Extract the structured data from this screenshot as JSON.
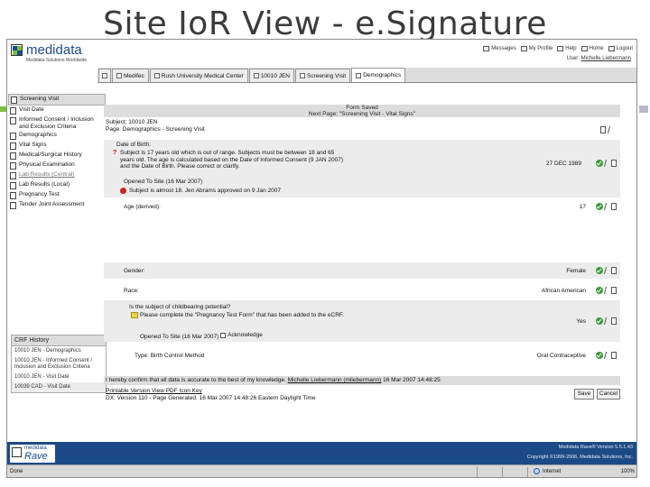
{
  "slide": {
    "title": "Site IoR View - e.Signature"
  },
  "header": {
    "logo_word": "medidata",
    "logo_tagline": "Medidata Solutions Worldwide",
    "links": [
      "Messages",
      "My Profile",
      "Help",
      "Home",
      "Logout"
    ],
    "user_prefix": "User:",
    "user_name": "Michelle Liebermann"
  },
  "tabs": [
    "Medifec",
    "Rush University Medical Center",
    "10010 JEN",
    "Screening Visit",
    "Demographics"
  ],
  "leftnav": {
    "items": [
      {
        "label": "Screening Visit",
        "active": true,
        "muted": false
      },
      {
        "label": "Visit Date",
        "active": false,
        "muted": false
      },
      {
        "label": "Informed Consent / Inclusion and Exclusion Criteria",
        "active": false,
        "muted": false
      },
      {
        "label": "Demographics",
        "active": false,
        "muted": false
      },
      {
        "label": "Vital Signs",
        "active": false,
        "muted": false
      },
      {
        "label": "Medical/Surgical History",
        "active": false,
        "muted": false
      },
      {
        "label": "Physical Examination",
        "active": false,
        "muted": false
      },
      {
        "label": "Lab Results (Central)",
        "active": false,
        "muted": true
      },
      {
        "label": "Lab Results (Local)",
        "active": false,
        "muted": false
      },
      {
        "label": "Pregnancy Test",
        "active": false,
        "muted": false
      },
      {
        "label": "Tender Joint Assessment",
        "active": false,
        "muted": false
      }
    ]
  },
  "crf_history": {
    "title": "CRF History",
    "items": [
      "10010 JEN - Demographics",
      "10010 JEN - Informed Consent / Inclusion and Exclusion Criteria",
      "10010 JEN - Visit Date",
      "10039 CAD - Visit Date"
    ]
  },
  "form": {
    "saved_title": "Form Saved",
    "saved_subtitle": "Next Page: \"Screening Visit - Vital Signs\"",
    "subject": "Subject: 10010 JEN",
    "page": "Page: Demographics - Screening Visit",
    "dob": {
      "label": "Date of Birth:",
      "query": "Subject is 17 years old which is out of range. Subjects must be between 18 and 65 years old. The age is calculated based on the Date of Informed Consent (9 JAN 2007) and the Date of Birth. Please correct or clarify.",
      "opened": "Opened To Site (16 Mar 2007)",
      "approval": "Subject is almost 18. Jen Abrams approved on 9 Jan 2007",
      "value": "27 DEC 1989"
    },
    "age": {
      "label": "Age (derived):",
      "value": "17"
    },
    "gender": {
      "label": "Gender:",
      "value": "Female"
    },
    "race": {
      "label": "Race:",
      "value": "African American"
    },
    "childbearing": {
      "label": "Is the subject of childbearing potential?",
      "sticky": "Please complete the \"Pregnancy Test Form\" that has been added to the eCRF.",
      "opened": "Opened To Site (16 Mar 2007)",
      "ack": "Acknowledge",
      "value": "Yes"
    },
    "birth_control": {
      "label": "Type: Birth Control Method",
      "value": "Oral Contraceptive"
    },
    "signature": {
      "text_before": "I hereby confirm that all data is accurate to the best of my knowledge.",
      "signer": "Michelle Liebermann (mliebermann)",
      "date": "16 Mar 2007 14:48:25"
    },
    "print_links": "Printable Version  View PDF  Icon Key",
    "version_line": "DX: Version 110 - Page Generated: 16 Mar 2007 14:48:26 Eastern Daylight Time",
    "save_label": "Save",
    "cancel_label": "Cancel"
  },
  "footer": {
    "rave_top": "medidata",
    "rave_name": "Rave",
    "version": "Medidata Rave® Version 5.5.1.43",
    "copyright": "Copyright ©1999-2006, Medidata Solutions, Inc."
  },
  "statusbar": {
    "text": "Done",
    "zone": "Internet",
    "zoom": "100%"
  },
  "colors": {
    "footer_blue": "#1c4a86",
    "check_green": "#3a9a3a",
    "query_red": "#cc0000",
    "sticky_yellow": "#e8d44a"
  }
}
